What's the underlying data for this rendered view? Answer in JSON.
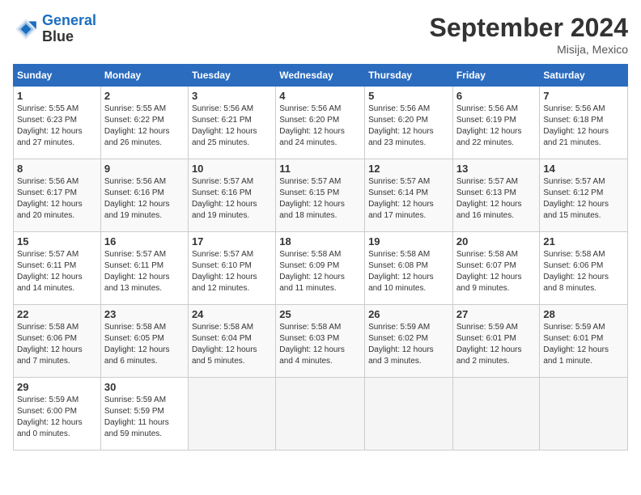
{
  "header": {
    "logo_line1": "General",
    "logo_line2": "Blue",
    "month": "September 2024",
    "location": "Misija, Mexico"
  },
  "weekdays": [
    "Sunday",
    "Monday",
    "Tuesday",
    "Wednesday",
    "Thursday",
    "Friday",
    "Saturday"
  ],
  "weeks": [
    [
      {
        "day": "1",
        "info": "Sunrise: 5:55 AM\nSunset: 6:23 PM\nDaylight: 12 hours\nand 27 minutes."
      },
      {
        "day": "2",
        "info": "Sunrise: 5:55 AM\nSunset: 6:22 PM\nDaylight: 12 hours\nand 26 minutes."
      },
      {
        "day": "3",
        "info": "Sunrise: 5:56 AM\nSunset: 6:21 PM\nDaylight: 12 hours\nand 25 minutes."
      },
      {
        "day": "4",
        "info": "Sunrise: 5:56 AM\nSunset: 6:20 PM\nDaylight: 12 hours\nand 24 minutes."
      },
      {
        "day": "5",
        "info": "Sunrise: 5:56 AM\nSunset: 6:20 PM\nDaylight: 12 hours\nand 23 minutes."
      },
      {
        "day": "6",
        "info": "Sunrise: 5:56 AM\nSunset: 6:19 PM\nDaylight: 12 hours\nand 22 minutes."
      },
      {
        "day": "7",
        "info": "Sunrise: 5:56 AM\nSunset: 6:18 PM\nDaylight: 12 hours\nand 21 minutes."
      }
    ],
    [
      {
        "day": "8",
        "info": "Sunrise: 5:56 AM\nSunset: 6:17 PM\nDaylight: 12 hours\nand 20 minutes."
      },
      {
        "day": "9",
        "info": "Sunrise: 5:56 AM\nSunset: 6:16 PM\nDaylight: 12 hours\nand 19 minutes."
      },
      {
        "day": "10",
        "info": "Sunrise: 5:57 AM\nSunset: 6:16 PM\nDaylight: 12 hours\nand 19 minutes."
      },
      {
        "day": "11",
        "info": "Sunrise: 5:57 AM\nSunset: 6:15 PM\nDaylight: 12 hours\nand 18 minutes."
      },
      {
        "day": "12",
        "info": "Sunrise: 5:57 AM\nSunset: 6:14 PM\nDaylight: 12 hours\nand 17 minutes."
      },
      {
        "day": "13",
        "info": "Sunrise: 5:57 AM\nSunset: 6:13 PM\nDaylight: 12 hours\nand 16 minutes."
      },
      {
        "day": "14",
        "info": "Sunrise: 5:57 AM\nSunset: 6:12 PM\nDaylight: 12 hours\nand 15 minutes."
      }
    ],
    [
      {
        "day": "15",
        "info": "Sunrise: 5:57 AM\nSunset: 6:11 PM\nDaylight: 12 hours\nand 14 minutes."
      },
      {
        "day": "16",
        "info": "Sunrise: 5:57 AM\nSunset: 6:11 PM\nDaylight: 12 hours\nand 13 minutes."
      },
      {
        "day": "17",
        "info": "Sunrise: 5:57 AM\nSunset: 6:10 PM\nDaylight: 12 hours\nand 12 minutes."
      },
      {
        "day": "18",
        "info": "Sunrise: 5:58 AM\nSunset: 6:09 PM\nDaylight: 12 hours\nand 11 minutes."
      },
      {
        "day": "19",
        "info": "Sunrise: 5:58 AM\nSunset: 6:08 PM\nDaylight: 12 hours\nand 10 minutes."
      },
      {
        "day": "20",
        "info": "Sunrise: 5:58 AM\nSunset: 6:07 PM\nDaylight: 12 hours\nand 9 minutes."
      },
      {
        "day": "21",
        "info": "Sunrise: 5:58 AM\nSunset: 6:06 PM\nDaylight: 12 hours\nand 8 minutes."
      }
    ],
    [
      {
        "day": "22",
        "info": "Sunrise: 5:58 AM\nSunset: 6:06 PM\nDaylight: 12 hours\nand 7 minutes."
      },
      {
        "day": "23",
        "info": "Sunrise: 5:58 AM\nSunset: 6:05 PM\nDaylight: 12 hours\nand 6 minutes."
      },
      {
        "day": "24",
        "info": "Sunrise: 5:58 AM\nSunset: 6:04 PM\nDaylight: 12 hours\nand 5 minutes."
      },
      {
        "day": "25",
        "info": "Sunrise: 5:58 AM\nSunset: 6:03 PM\nDaylight: 12 hours\nand 4 minutes."
      },
      {
        "day": "26",
        "info": "Sunrise: 5:59 AM\nSunset: 6:02 PM\nDaylight: 12 hours\nand 3 minutes."
      },
      {
        "day": "27",
        "info": "Sunrise: 5:59 AM\nSunset: 6:01 PM\nDaylight: 12 hours\nand 2 minutes."
      },
      {
        "day": "28",
        "info": "Sunrise: 5:59 AM\nSunset: 6:01 PM\nDaylight: 12 hours\nand 1 minute."
      }
    ],
    [
      {
        "day": "29",
        "info": "Sunrise: 5:59 AM\nSunset: 6:00 PM\nDaylight: 12 hours\nand 0 minutes."
      },
      {
        "day": "30",
        "info": "Sunrise: 5:59 AM\nSunset: 5:59 PM\nDaylight: 11 hours\nand 59 minutes."
      },
      {
        "day": "",
        "info": ""
      },
      {
        "day": "",
        "info": ""
      },
      {
        "day": "",
        "info": ""
      },
      {
        "day": "",
        "info": ""
      },
      {
        "day": "",
        "info": ""
      }
    ]
  ]
}
